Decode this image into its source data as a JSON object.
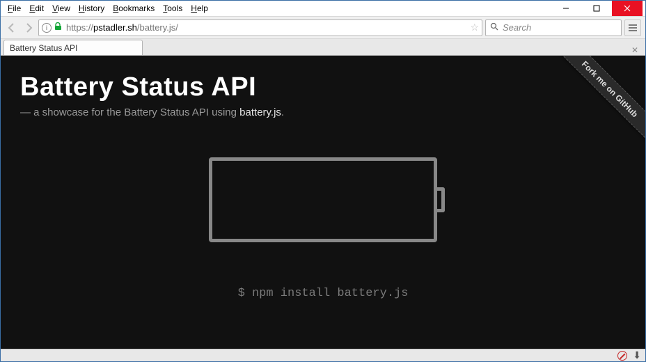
{
  "menu": {
    "file": "File",
    "edit": "Edit",
    "view": "View",
    "history": "History",
    "bookmarks": "Bookmarks",
    "tools": "Tools",
    "help": "Help"
  },
  "url": {
    "protocol": "https://",
    "domain": "pstadler.sh",
    "path": "/battery.js/"
  },
  "search": {
    "placeholder": "Search"
  },
  "tab": {
    "title": "Battery Status API"
  },
  "page": {
    "heading": "Battery Status API",
    "subtitle_pre": "— a showcase for the Battery Status API using ",
    "subtitle_strong": "battery.js",
    "subtitle_post": ".",
    "install_cmd": "$ npm install battery.js",
    "ribbon": "Fork me on GitHub"
  }
}
